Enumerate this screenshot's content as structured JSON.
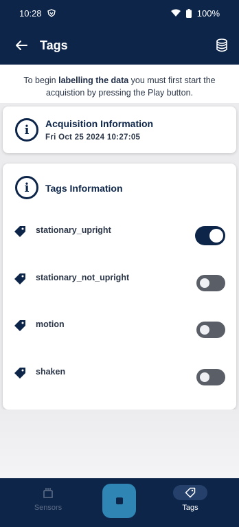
{
  "status_bar": {
    "time": "10:28",
    "battery": "100%"
  },
  "app_bar": {
    "title": "Tags"
  },
  "instruction": {
    "part1": "To begin ",
    "bold": "labelling the data",
    "part2": " you must first start the acquistion by pressing the Play button."
  },
  "acquisition": {
    "title": "Acquisition Information",
    "timestamp": "Fri Oct 25 2024 10:27:05"
  },
  "tags": {
    "title": "Tags Information",
    "items": [
      {
        "label": "stationary_upright",
        "enabled": true
      },
      {
        "label": "stationary_not_upright",
        "enabled": false
      },
      {
        "label": "motion",
        "enabled": false
      },
      {
        "label": "shaken",
        "enabled": false
      }
    ]
  },
  "bottom_nav": {
    "sensors_label": "Sensors",
    "tags_label": "Tags"
  },
  "icons": {
    "back": "arrow-left-icon",
    "database": "database-icon",
    "info": "info-icon",
    "tag": "tag-icon",
    "sensors": "sensors-icon",
    "stop": "stop-icon"
  },
  "colors": {
    "primary": "#0d2549",
    "accent": "#2f86b4",
    "toggle_off": "#5a5e66"
  }
}
